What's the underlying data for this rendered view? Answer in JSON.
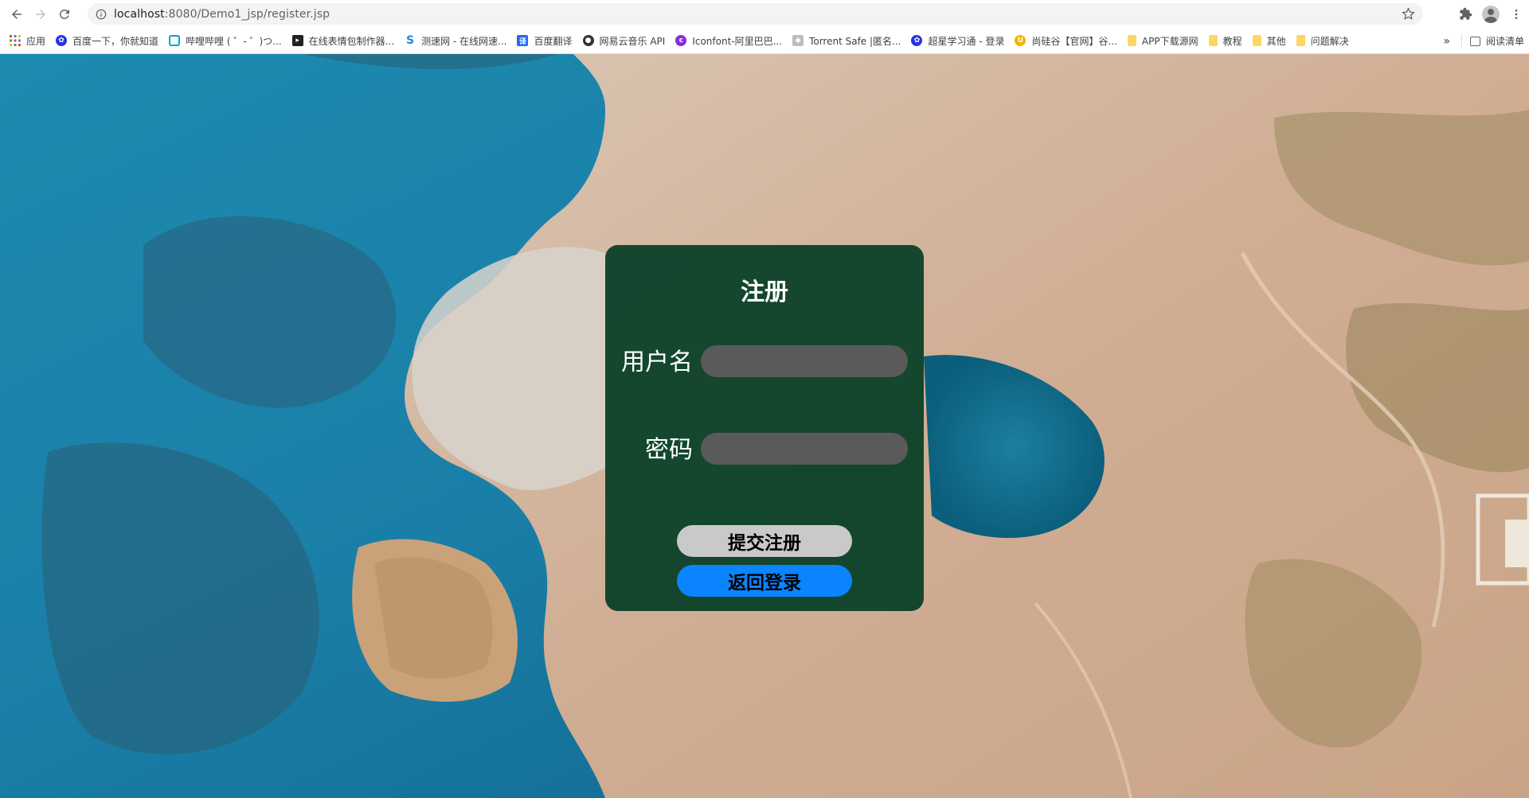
{
  "browser": {
    "url_host": "localhost",
    "url_rest": ":8080/Demo1_jsp/register.jsp"
  },
  "bookmarks": {
    "items": [
      {
        "label": "应用",
        "icon": "apps-grid-icon",
        "color": "#4285f4"
      },
      {
        "label": "百度一下，你就知道",
        "icon": "baidu-paw-icon",
        "color": "#2932e1"
      },
      {
        "label": "哔哩哔哩 ( ゜- ゜)つ...",
        "icon": "bilibili-tv-icon",
        "color": "#00a1d6"
      },
      {
        "label": "在线表情包制作器...",
        "icon": "meme-maker-icon",
        "color": "#222222"
      },
      {
        "label": "测速网 - 在线网速...",
        "icon": "speedtest-icon",
        "color": "#1e88e5"
      },
      {
        "label": "百度翻译",
        "icon": "baidu-translate-icon",
        "color": "#2468f2"
      },
      {
        "label": "网易云音乐 API",
        "icon": "github-icon",
        "color": "#333333"
      },
      {
        "label": "Iconfont-阿里巴巴...",
        "icon": "iconfont-icon",
        "color": "#8a2be2"
      },
      {
        "label": "Torrent Safe |匿名...",
        "icon": "torrent-safe-icon",
        "color": "#bdbdbd"
      },
      {
        "label": "超星学习通 - 登录",
        "icon": "baidu-paw-icon",
        "color": "#2932e1"
      },
      {
        "label": "尚硅谷【官网】谷...",
        "icon": "atguigu-icon",
        "color": "#f4b400"
      },
      {
        "label": "APP下载源网",
        "icon": "folder-icon",
        "color": "#fdd663"
      },
      {
        "label": "教程",
        "icon": "folder-icon",
        "color": "#fdd663"
      },
      {
        "label": "其他",
        "icon": "folder-icon",
        "color": "#fdd663"
      },
      {
        "label": "问题解决",
        "icon": "folder-icon",
        "color": "#fdd663"
      }
    ],
    "overflow_label": "»",
    "reading_list_label": "阅读清单"
  },
  "form": {
    "title": "注册",
    "username_label": "用户名",
    "username_value": "",
    "password_label": "密码",
    "password_value": "",
    "submit_label": "提交注册",
    "back_label": "返回登录"
  },
  "colors": {
    "panel_bg": "#053e26",
    "input_bg": "#5a5a5a",
    "submit_bg": "#c9c9c9",
    "back_bg": "#0a84ff"
  }
}
